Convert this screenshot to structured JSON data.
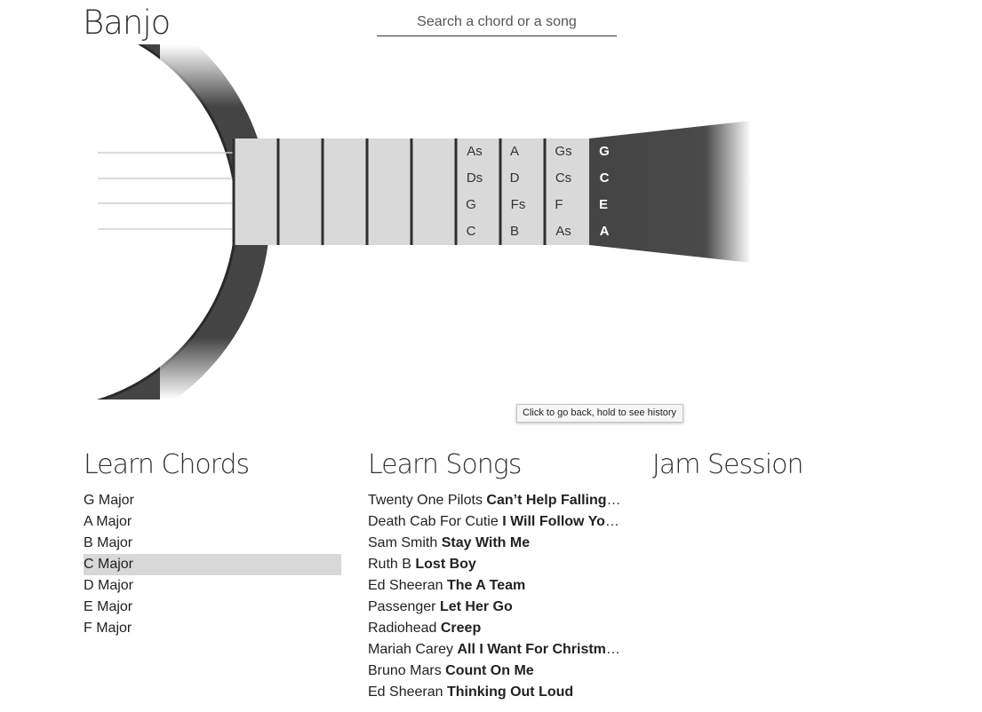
{
  "app": {
    "title": "Banjo"
  },
  "search": {
    "placeholder": "Search a chord or a song"
  },
  "fretboard": {
    "fret_notes": [
      [
        "As",
        "A",
        "Gs"
      ],
      [
        "Ds",
        "D",
        "Cs"
      ],
      [
        "G",
        "Fs",
        "F"
      ],
      [
        "C",
        "B",
        "As"
      ]
    ],
    "open_strings": [
      "G",
      "C",
      "E",
      "A"
    ],
    "colors": {
      "neck": "#d9d9d9",
      "headstock": "#444444",
      "fret": "#333333",
      "rim": "#444444"
    }
  },
  "tooltip": {
    "text": "Click to go back, hold to see history"
  },
  "sections": {
    "chords_title": "Learn Chords",
    "songs_title": "Learn Songs",
    "jam_title": "Jam Session"
  },
  "chords": [
    {
      "label": "G Major"
    },
    {
      "label": "A Major"
    },
    {
      "label": "B Major"
    },
    {
      "label": "C Major"
    },
    {
      "label": "D Major"
    },
    {
      "label": "E Major"
    },
    {
      "label": "F Major"
    }
  ],
  "selected_chord": "C Major",
  "songs": [
    {
      "artist": "Twenty One Pilots",
      "title": "Can’t Help Falling in Love"
    },
    {
      "artist": "Death Cab For Cutie",
      "title": "I Will Follow You into the Dark"
    },
    {
      "artist": "Sam Smith",
      "title": "Stay With Me"
    },
    {
      "artist": "Ruth B",
      "title": "Lost Boy"
    },
    {
      "artist": "Ed Sheeran",
      "title": "The A Team"
    },
    {
      "artist": "Passenger",
      "title": "Let Her Go"
    },
    {
      "artist": "Radiohead",
      "title": "Creep"
    },
    {
      "artist": "Mariah Carey",
      "title": "All I Want For Christmas Is You"
    },
    {
      "artist": "Bruno Mars",
      "title": "Count On Me"
    },
    {
      "artist": "Ed Sheeran",
      "title": "Thinking Out Loud"
    }
  ]
}
